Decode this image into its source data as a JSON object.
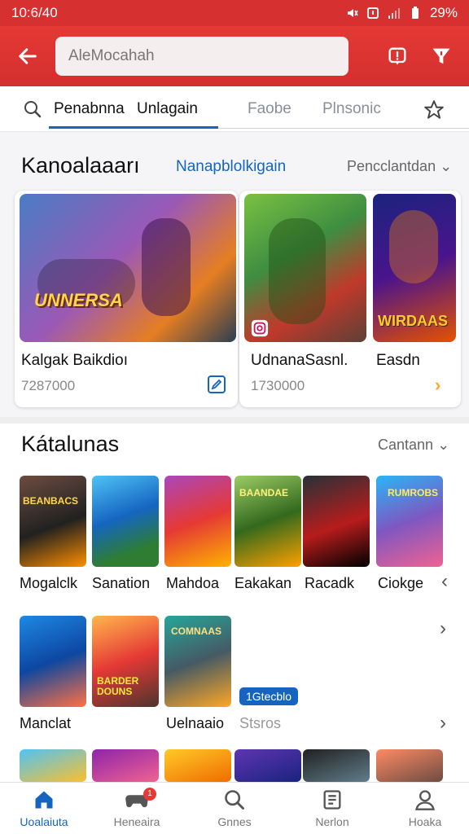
{
  "status": {
    "time": "10:6/40",
    "battery": "29%"
  },
  "appbar": {
    "search_text": "AleMocahah"
  },
  "tabs": [
    {
      "label": "Penabnna"
    },
    {
      "label": "Unlagain"
    },
    {
      "label": "Faobe"
    },
    {
      "label": "Plnsonic"
    }
  ],
  "section1": {
    "title": "Kanoalaaarı",
    "link": "Nanapblolkigain",
    "more": "Pencclantdan",
    "cards": [
      {
        "title": "Kalgak Baikdioı",
        "sub": "7287000",
        "art_text": "UNNERSA"
      },
      {
        "title": "UdnanaSasnl.",
        "sub": "1730000"
      },
      {
        "title": "Easdn",
        "art_text": "WIRDAAS"
      }
    ]
  },
  "section2": {
    "title": "Kátalunas",
    "more": "Cantann",
    "row1": [
      {
        "label": "Mogalclk",
        "art": "BEANBACS"
      },
      {
        "label": "Sanation",
        "art": ""
      },
      {
        "label": "Mahdoa",
        "art": ""
      },
      {
        "label": "Eakakan",
        "art": "BAANDAE"
      },
      {
        "label": "Racadk",
        "art": ""
      },
      {
        "label": "Ciokge",
        "art": "RUMROBS"
      }
    ],
    "row2": [
      {
        "label": "Manclat",
        "art": ""
      },
      {
        "label": "Uelnaaio",
        "art": "BARDER DOUNS"
      },
      {
        "label": "",
        "art": "COMNAAS"
      }
    ],
    "row2_badge": "1Gtecblo",
    "row2_extra": "Stsros"
  },
  "bottomnav": [
    {
      "label": "Uoalaiuta",
      "icon": "home-icon"
    },
    {
      "label": "Heneaira",
      "icon": "gamepad-icon",
      "badge": "1"
    },
    {
      "label": "Gnnes",
      "icon": "search-icon"
    },
    {
      "label": "Nerlon",
      "icon": "list-icon"
    },
    {
      "label": "Hoaka",
      "icon": "profile-icon"
    }
  ],
  "colors": {
    "brand_red": "#e53935",
    "accent_blue": "#1565c0"
  }
}
